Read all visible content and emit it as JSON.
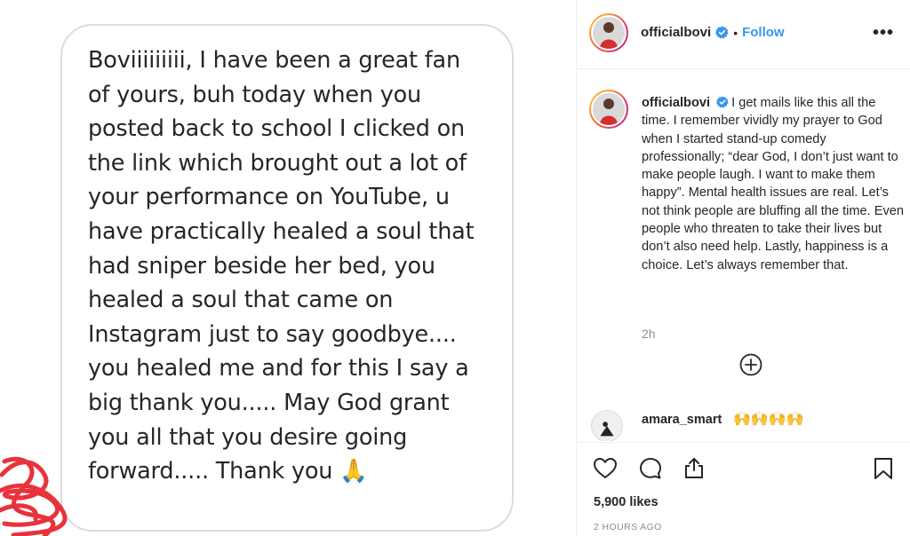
{
  "message": {
    "text": "Boviiiiiiiii, I have been a great fan of yours, buh today when you posted back to school I clicked on the link which brought out a lot of your performance on YouTube, u have practically healed a soul that had sniper beside her bed, you healed a soul that came on Instagram just to say goodbye.... you healed me and for this I say a big thank you..... May God grant you all that you desire going forward..... Thank you 🙏"
  },
  "header": {
    "username": "officialbovi",
    "separator": "•",
    "follow_label": "Follow",
    "more_label": "•••"
  },
  "post": {
    "username": "officialbovi",
    "caption": "I get mails like this all the time. I remember vividly my prayer to God when I started stand-up comedy professionally; “dear God, I don’t just want to make people laugh. I want to make them happy”. Mental health issues are real. Let’s not think people are bluffing all the time. Even people who threaten to take their lives but don’t also need help. Lastly, happiness is a choice. Let’s always remember that.",
    "time_ago": "2h"
  },
  "comment": {
    "username": "amara_smart",
    "text": "🙌🙌🙌🙌"
  },
  "footer": {
    "likes": "5,900 likes",
    "posted": "2 HOURS AGO"
  },
  "colors": {
    "accent_blue": "#3897f0",
    "text": "#262626",
    "muted": "#8e8e8e",
    "scribble": "#e8323c"
  },
  "icons": [
    "verified-badge-icon",
    "more-options-icon",
    "add-comment-icon",
    "heart-icon",
    "comment-icon",
    "share-icon",
    "bookmark-icon"
  ]
}
